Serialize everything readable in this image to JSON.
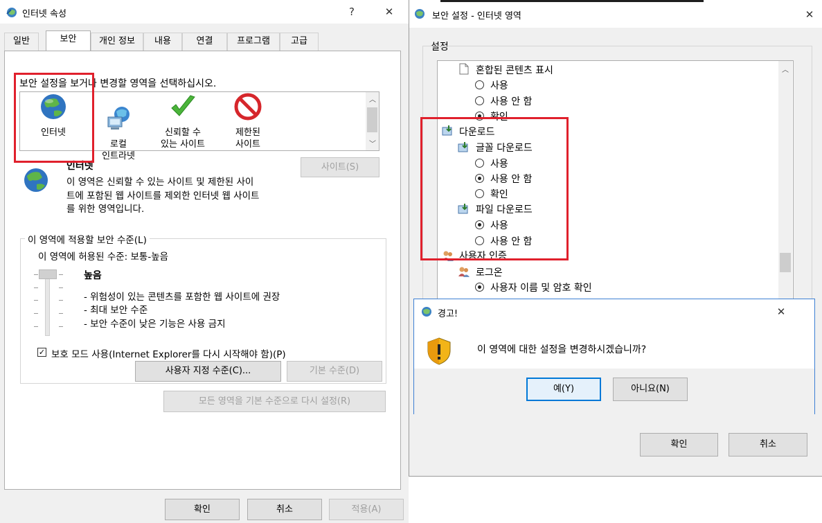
{
  "internet_options": {
    "title": "인터넷 속성",
    "help": "?",
    "close": "✕",
    "tabs": [
      "일반",
      "보안",
      "개인 정보",
      "내용",
      "연결",
      "프로그램",
      "고급"
    ],
    "select_zone_text": "보안 설정을 보거나 변경할 영역을 선택하십시오.",
    "zones": [
      {
        "label": "인터넷"
      },
      {
        "label": "로컬\n인트라넷"
      },
      {
        "label": "신뢰할 수\n있는 사이트"
      },
      {
        "label": "제한된\n사이트"
      }
    ],
    "zone_name": "인터넷",
    "zone_desc_1": "이 영역은 신뢰할 수 있는 사이트 및 제한된 사이",
    "zone_desc_2": "트에 포함된 웹 사이트를 제외한 인터넷 웹 사이트",
    "zone_desc_3": "를 위한 영역입니다.",
    "sites_button": "사이트(S)",
    "level_group_title": "이 영역에 적용할 보안 수준(L)",
    "allowed_level": "이 영역에 허용된 수준: 보통-높음",
    "level_name": "높음",
    "level_items": [
      "- 위험성이 있는 콘텐츠를 포함한 웹 사이트에 권장",
      "- 최대 보안 수준",
      "- 보안 수준이 낮은 기능은 사용 금지"
    ],
    "protected_mode": "보호 모드 사용(Internet Explorer를 다시 시작해야 함)(P)",
    "custom_level_button": "사용자 지정 수준(C)...",
    "default_level_button": "기본 수준(D)",
    "reset_all_button": "모든 영역을 기본 수준으로 다시 설정(R)",
    "ok": "확인",
    "cancel": "취소",
    "apply": "적용(A)"
  },
  "security_settings": {
    "title": "보안 설정 - 인터넷 영역",
    "close": "✕",
    "group_label": "설정",
    "tree": {
      "mixed_content": "혼합된 콘텐츠 표시",
      "mixed_options": [
        "사용",
        "사용 안 함",
        "확인"
      ],
      "download": "다운로드",
      "font_download": "글꼴 다운로드",
      "font_options": [
        "사용",
        "사용 안 함",
        "확인"
      ],
      "file_download": "파일 다운로드",
      "file_options": [
        "사용",
        "사용 안 함"
      ],
      "user_auth": "사용자 인증",
      "logon": "로그온",
      "logon_option": "사용자 이름 및 암호 확인"
    },
    "ok": "확인",
    "cancel": "취소"
  },
  "warning": {
    "title": "경고!",
    "close": "✕",
    "message": "이 영역에 대한 설정을 변경하시겠습니까?",
    "yes": "예(Y)",
    "no": "아니요(N)"
  }
}
